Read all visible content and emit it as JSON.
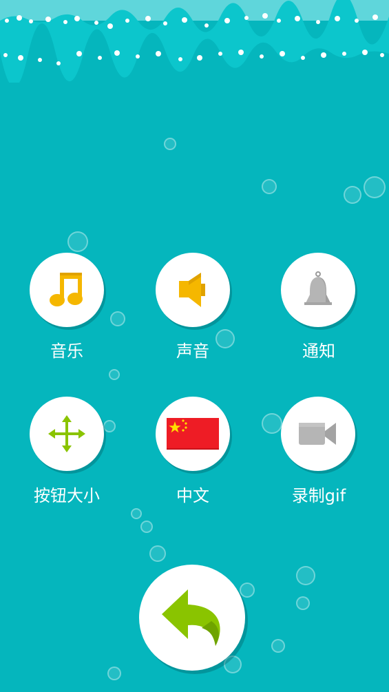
{
  "colors": {
    "background": "#05b6bd",
    "accent_yellow": "#f5b700",
    "accent_green": "#8ac400",
    "icon_gray": "#b5b5b5",
    "flag_red": "#ee1c25",
    "flag_star": "#ffde00"
  },
  "settings": {
    "items": [
      {
        "label": "音乐",
        "icon": "music-note-icon"
      },
      {
        "label": "声音",
        "icon": "speaker-icon"
      },
      {
        "label": "通知",
        "icon": "bell-icon"
      },
      {
        "label": "按钮大小",
        "icon": "move-arrows-icon"
      },
      {
        "label": "中文",
        "icon": "china-flag-icon"
      },
      {
        "label": "录制gif",
        "icon": "video-camera-icon"
      }
    ]
  },
  "back_button": {
    "icon": "back-arrow-icon"
  }
}
